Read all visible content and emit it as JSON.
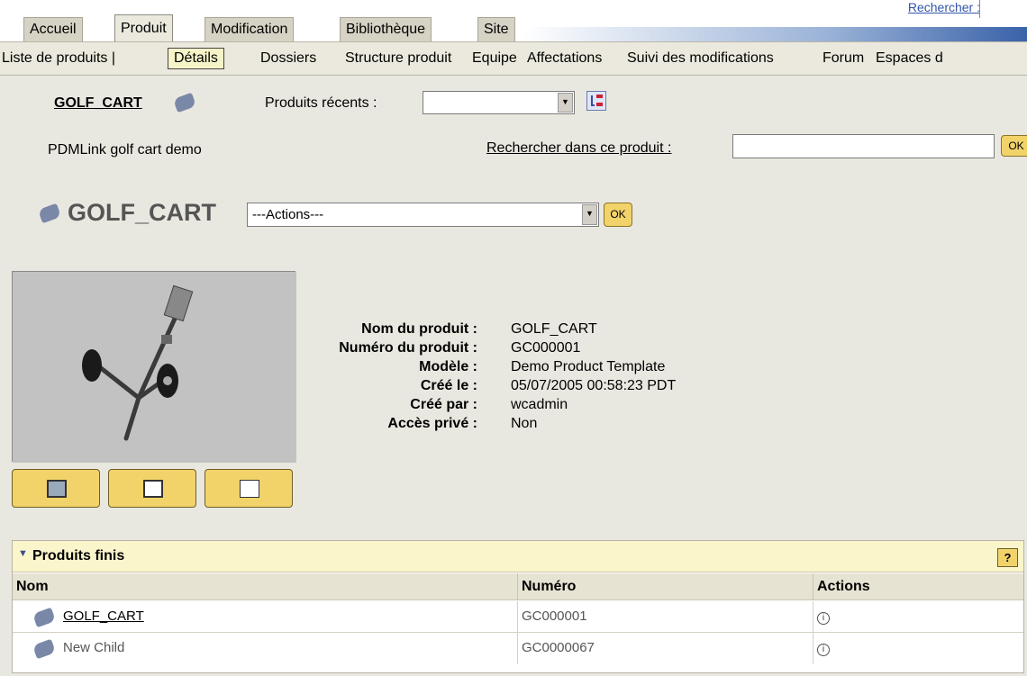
{
  "tabs": [
    "Accueil",
    "Produit",
    "Modification",
    "Bibliothèque",
    "Site"
  ],
  "top_search": "Rechercher :",
  "subnav": {
    "product_list": "Liste de produits |",
    "details": "Détails",
    "items": [
      "Dossiers",
      "Structure produit",
      "Equipe",
      "Affectations",
      "Suivi des modifications",
      "Forum",
      "Espaces d"
    ]
  },
  "context": {
    "product_link": "GOLF_CART",
    "recent_label": "Produits récents :",
    "recent_value": "",
    "description": "PDMLink golf cart demo",
    "search_in_product": "Rechercher dans ce produit :",
    "search_value": "",
    "ok_label": "OK"
  },
  "header": {
    "title": "GOLF_CART",
    "actions_value": "---Actions---",
    "ok_label": "OK"
  },
  "properties": [
    {
      "label": "Nom du produit :",
      "value": "GOLF_CART"
    },
    {
      "label": "Numéro du produit :",
      "value": "GC000001"
    },
    {
      "label": "Modèle :",
      "value": "Demo Product Template"
    },
    {
      "label": "Créé le :",
      "value": "05/07/2005 00:58:23 PDT"
    },
    {
      "label": "Créé par :",
      "value": "wcadmin"
    },
    {
      "label": "Accès privé :",
      "value": "Non"
    }
  ],
  "finished": {
    "title": "Produits finis",
    "help": "?",
    "columns": [
      "Nom",
      "Numéro",
      "Actions"
    ],
    "rows": [
      {
        "name": "GOLF_CART",
        "number": "GC000001",
        "action": "i"
      },
      {
        "name": "New Child",
        "number": "GC0000067",
        "action": "i"
      }
    ]
  },
  "colors": {
    "page_bg": "#e9e8e0",
    "button_yellow": "#f2d36a",
    "panel_header": "#fbf5cc",
    "link_blue": "#3355aa"
  }
}
